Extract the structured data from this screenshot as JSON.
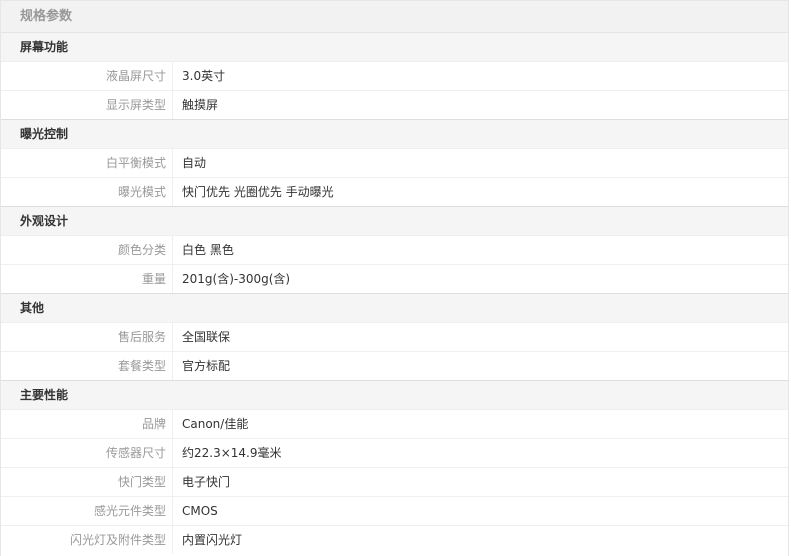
{
  "header": {
    "title": "规格参数"
  },
  "groups": [
    {
      "title": "屏幕功能",
      "rows": [
        {
          "label": "液晶屏尺寸",
          "value": "3.0英寸"
        },
        {
          "label": "显示屏类型",
          "value": "触摸屏"
        }
      ]
    },
    {
      "title": "曝光控制",
      "rows": [
        {
          "label": "白平衡模式",
          "value": "自动"
        },
        {
          "label": "曝光模式",
          "value": "快门优先 光圈优先 手动曝光"
        }
      ]
    },
    {
      "title": "外观设计",
      "rows": [
        {
          "label": "颜色分类",
          "value": "白色 黑色"
        },
        {
          "label": "重量",
          "value": "201g(含)-300g(含)"
        }
      ]
    },
    {
      "title": "其他",
      "rows": [
        {
          "label": "售后服务",
          "value": "全国联保"
        },
        {
          "label": "套餐类型",
          "value": "官方标配"
        }
      ]
    },
    {
      "title": "主要性能",
      "rows": [
        {
          "label": "品牌",
          "value": "Canon/佳能"
        },
        {
          "label": "传感器尺寸",
          "value": "约22.3×14.9毫米"
        },
        {
          "label": "快门类型",
          "value": "电子快门"
        },
        {
          "label": "感光元件类型",
          "value": "CMOS"
        },
        {
          "label": "闪光灯及附件类型",
          "value": "内置闪光灯"
        }
      ]
    }
  ]
}
